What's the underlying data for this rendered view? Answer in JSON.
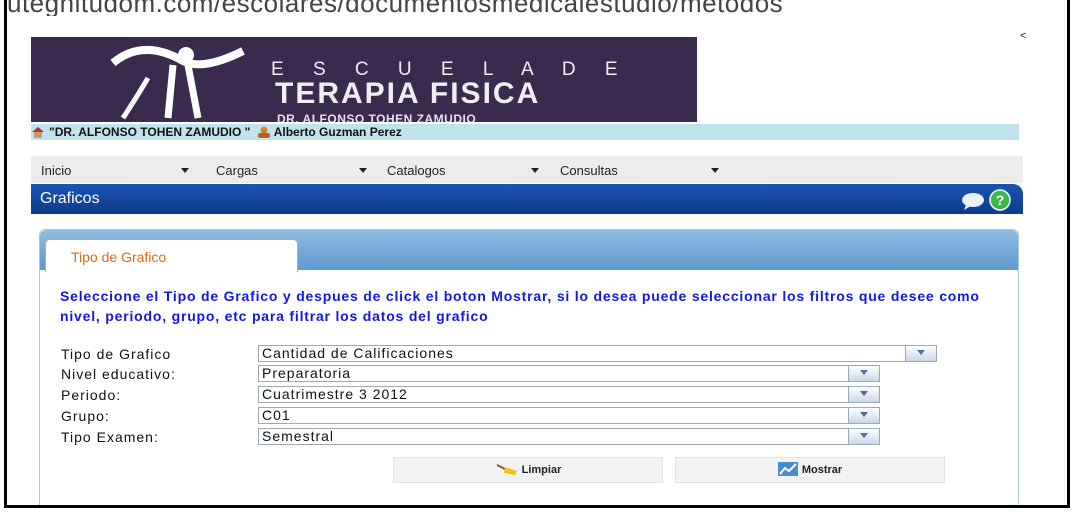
{
  "browser": {
    "url_text": "utegnitudom.com/escolares/documentosmedicalestudio/metodos"
  },
  "banner": {
    "line1": "E S C U E L A   D E",
    "line2": "TERAPIA FISICA",
    "line3": "DR. ALFONSO TOHEN ZAMUDIO"
  },
  "info": {
    "school": "\"DR. ALFONSO TOHEN ZAMUDIO \"",
    "user": "Alberto Guzman Perez"
  },
  "menu": [
    "Inicio",
    "Cargas",
    "Catalogos",
    "Consultas"
  ],
  "page_title": "Graficos",
  "tab": {
    "label": "Tipo de Grafico"
  },
  "instructions": "Seleccione el Tipo de Grafico y despues de click el boton Mostrar, si lo desea puede seleccionar los filtros que desee como nivel, periodo, grupo, etc para filtrar los datos del grafico",
  "form": {
    "tipo_grafico": {
      "label": "Tipo de Grafico",
      "value": "Cantidad de Calificaciones"
    },
    "nivel": {
      "label": "Nivel educativo:",
      "value": "Preparatoria"
    },
    "periodo": {
      "label": "Periodo:",
      "value": "Cuatrimestre 3 2012"
    },
    "grupo": {
      "label": "Grupo:",
      "value": "C01"
    },
    "tipo_examen": {
      "label": "Tipo Examen:",
      "value": "Semestral"
    }
  },
  "buttons": {
    "limpiar": "Limpiar",
    "mostrar": "Mostrar"
  },
  "colors": {
    "banner": "#3a2a4e",
    "titlebar": "#0c3a8c",
    "instructions": "#1018e8",
    "tab_text": "#e06a0a"
  }
}
